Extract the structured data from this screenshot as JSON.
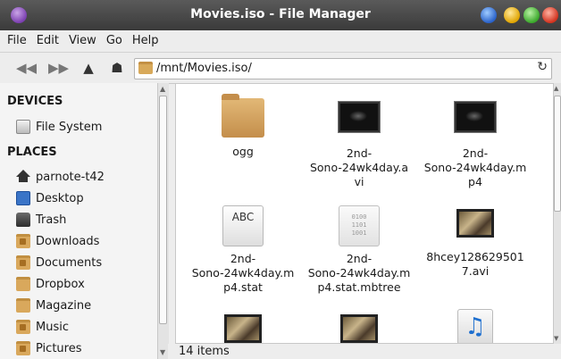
{
  "window": {
    "title": "Movies.iso - File Manager"
  },
  "menu": [
    "File",
    "Edit",
    "View",
    "Go",
    "Help"
  ],
  "toolbar": {
    "path": "/mnt/Movies.iso/",
    "icons": [
      "back-arrow-icon",
      "forward-arrow-icon",
      "up-arrow-icon",
      "home-icon",
      "reload-icon"
    ]
  },
  "sidebar": {
    "devices_heading": "DEVICES",
    "devices": [
      {
        "label": "File System",
        "icon": "drive-icon"
      }
    ],
    "places_heading": "PLACES",
    "places": [
      {
        "label": "parnote-t42",
        "icon": "home-icon"
      },
      {
        "label": "Desktop",
        "icon": "desktop-icon"
      },
      {
        "label": "Trash",
        "icon": "trash-icon"
      },
      {
        "label": "Downloads",
        "icon": "downloads-folder-icon"
      },
      {
        "label": "Documents",
        "icon": "documents-folder-icon"
      },
      {
        "label": "Dropbox",
        "icon": "folder-icon"
      },
      {
        "label": "Magazine",
        "icon": "folder-icon"
      },
      {
        "label": "Music",
        "icon": "music-folder-icon"
      },
      {
        "label": "Pictures",
        "icon": "pictures-folder-icon"
      }
    ]
  },
  "files": [
    {
      "name": "ogg",
      "type": "folder"
    },
    {
      "name": "2nd-\nSono-24wk4day.a\nvi",
      "type": "video-dark"
    },
    {
      "name": "2nd-\nSono-24wk4day.m\np4",
      "type": "video-dark"
    },
    {
      "name": "2nd-\nSono-24wk4day.m\np4.stat",
      "type": "text"
    },
    {
      "name": "2nd-\nSono-24wk4day.m\np4.stat.mbtree",
      "type": "binary"
    },
    {
      "name": "8hcey128629501\n7.avi",
      "type": "video-photo"
    },
    {
      "name": "",
      "type": "video-photo"
    },
    {
      "name": "",
      "type": "video-photo"
    },
    {
      "name": "",
      "type": "audio"
    }
  ],
  "status": {
    "text": "14 items"
  },
  "glyphs": {
    "txt_preview": "ABC",
    "bin_preview": "0100\n1101\n1001",
    "music_note": "♫"
  }
}
